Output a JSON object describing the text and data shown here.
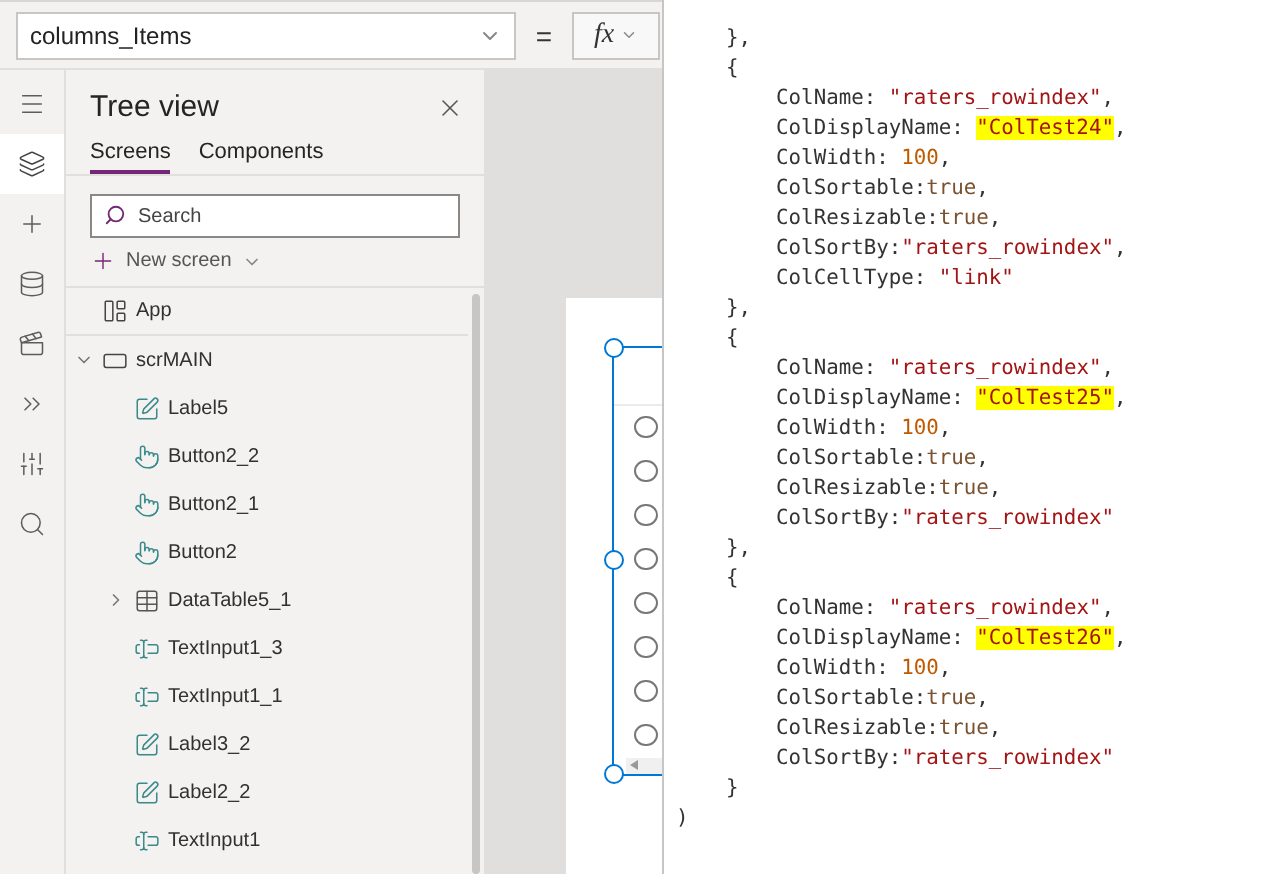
{
  "formula_bar": {
    "property": "columns_Items",
    "equals": "=",
    "fx": "fx"
  },
  "rail": [
    {
      "kind": "menu",
      "selected": false
    },
    {
      "kind": "tree",
      "selected": true
    },
    {
      "kind": "insert",
      "selected": false
    },
    {
      "kind": "data",
      "selected": false
    },
    {
      "kind": "media",
      "selected": false
    },
    {
      "kind": "advanced",
      "selected": false
    },
    {
      "kind": "tools",
      "selected": false
    },
    {
      "kind": "search",
      "selected": false
    }
  ],
  "tree_view": {
    "title": "Tree view",
    "tabs": [
      {
        "label": "Screens",
        "selected": true
      },
      {
        "label": "Components",
        "selected": false
      }
    ],
    "search": {
      "placeholder": "Search"
    },
    "new_screen": "New screen",
    "items": [
      {
        "label": "App",
        "kind": "app"
      },
      {
        "label": "scrMAIN",
        "kind": "screen",
        "expanded": true,
        "children": [
          {
            "label": "Label5",
            "kind": "label"
          },
          {
            "label": "Button2_2",
            "kind": "button"
          },
          {
            "label": "Button2_1",
            "kind": "button"
          },
          {
            "label": "Button2",
            "kind": "button"
          },
          {
            "label": "DataTable5_1",
            "kind": "datatable",
            "expanded": false
          },
          {
            "label": "TextInput1_3",
            "kind": "textinput"
          },
          {
            "label": "TextInput1_1",
            "kind": "textinput"
          },
          {
            "label": "Label3_2",
            "kind": "label"
          },
          {
            "label": "Label2_2",
            "kind": "label"
          },
          {
            "label": "TextInput1",
            "kind": "textinput"
          }
        ]
      }
    ]
  },
  "canvas": {
    "radio_rows": [
      {
        "selected": false
      },
      {
        "selected": false
      },
      {
        "selected": false
      },
      {
        "selected": false
      },
      {
        "selected": false
      },
      {
        "selected": false
      },
      {
        "selected": false
      },
      {
        "selected": false
      }
    ]
  },
  "code": [
    [
      {
        "kind": "plain",
        "text": "    },"
      }
    ],
    [
      {
        "kind": "plain",
        "text": "    {"
      }
    ],
    [
      {
        "kind": "plain",
        "text": "        ColName: "
      },
      {
        "kind": "string",
        "text": "\"raters_rowindex\""
      },
      {
        "kind": "plain",
        "text": ","
      }
    ],
    [
      {
        "kind": "plain",
        "text": "        ColDisplayName: "
      },
      {
        "kind": "highlight",
        "text": "\"ColTest24\""
      },
      {
        "kind": "plain",
        "text": ","
      }
    ],
    [
      {
        "kind": "plain",
        "text": "        ColWidth: "
      },
      {
        "kind": "number",
        "text": "100"
      },
      {
        "kind": "plain",
        "text": ","
      }
    ],
    [
      {
        "kind": "plain",
        "text": "        ColSortable:"
      },
      {
        "kind": "bool",
        "text": "true"
      },
      {
        "kind": "plain",
        "text": ","
      }
    ],
    [
      {
        "kind": "plain",
        "text": "        ColResizable:"
      },
      {
        "kind": "bool",
        "text": "true"
      },
      {
        "kind": "plain",
        "text": ","
      }
    ],
    [
      {
        "kind": "plain",
        "text": "        ColSortBy:"
      },
      {
        "kind": "string",
        "text": "\"raters_rowindex\""
      },
      {
        "kind": "plain",
        "text": ","
      }
    ],
    [
      {
        "kind": "plain",
        "text": "        ColCellType: "
      },
      {
        "kind": "string",
        "text": "\"link\""
      }
    ],
    [
      {
        "kind": "plain",
        "text": "    },"
      }
    ],
    [
      {
        "kind": "plain",
        "text": "    {"
      }
    ],
    [
      {
        "kind": "plain",
        "text": "        ColName: "
      },
      {
        "kind": "string",
        "text": "\"raters_rowindex\""
      },
      {
        "kind": "plain",
        "text": ","
      }
    ],
    [
      {
        "kind": "plain",
        "text": "        ColDisplayName: "
      },
      {
        "kind": "highlight",
        "text": "\"ColTest25\""
      },
      {
        "kind": "plain",
        "text": ","
      }
    ],
    [
      {
        "kind": "plain",
        "text": "        ColWidth: "
      },
      {
        "kind": "number",
        "text": "100"
      },
      {
        "kind": "plain",
        "text": ","
      }
    ],
    [
      {
        "kind": "plain",
        "text": "        ColSortable:"
      },
      {
        "kind": "bool",
        "text": "true"
      },
      {
        "kind": "plain",
        "text": ","
      }
    ],
    [
      {
        "kind": "plain",
        "text": "        ColResizable:"
      },
      {
        "kind": "bool",
        "text": "true"
      },
      {
        "kind": "plain",
        "text": ","
      }
    ],
    [
      {
        "kind": "plain",
        "text": "        ColSortBy:"
      },
      {
        "kind": "string",
        "text": "\"raters_rowindex\""
      }
    ],
    [
      {
        "kind": "plain",
        "text": "    },"
      }
    ],
    [
      {
        "kind": "plain",
        "text": "    {"
      }
    ],
    [
      {
        "kind": "plain",
        "text": "        ColName: "
      },
      {
        "kind": "string",
        "text": "\"raters_rowindex\""
      },
      {
        "kind": "plain",
        "text": ","
      }
    ],
    [
      {
        "kind": "plain",
        "text": "        ColDisplayName: "
      },
      {
        "kind": "highlight",
        "text": "\"ColTest26\""
      },
      {
        "kind": "plain",
        "text": ","
      }
    ],
    [
      {
        "kind": "plain",
        "text": "        ColWidth: "
      },
      {
        "kind": "number",
        "text": "100"
      },
      {
        "kind": "plain",
        "text": ","
      }
    ],
    [
      {
        "kind": "plain",
        "text": "        ColSortable:"
      },
      {
        "kind": "bool",
        "text": "true"
      },
      {
        "kind": "plain",
        "text": ","
      }
    ],
    [
      {
        "kind": "plain",
        "text": "        ColResizable:"
      },
      {
        "kind": "bool",
        "text": "true"
      },
      {
        "kind": "plain",
        "text": ","
      }
    ],
    [
      {
        "kind": "plain",
        "text": "        ColSortBy:"
      },
      {
        "kind": "string",
        "text": "\"raters_rowindex\""
      }
    ],
    [
      {
        "kind": "plain",
        "text": "    }"
      }
    ],
    [
      {
        "kind": "plain",
        "text": ")"
      }
    ]
  ]
}
